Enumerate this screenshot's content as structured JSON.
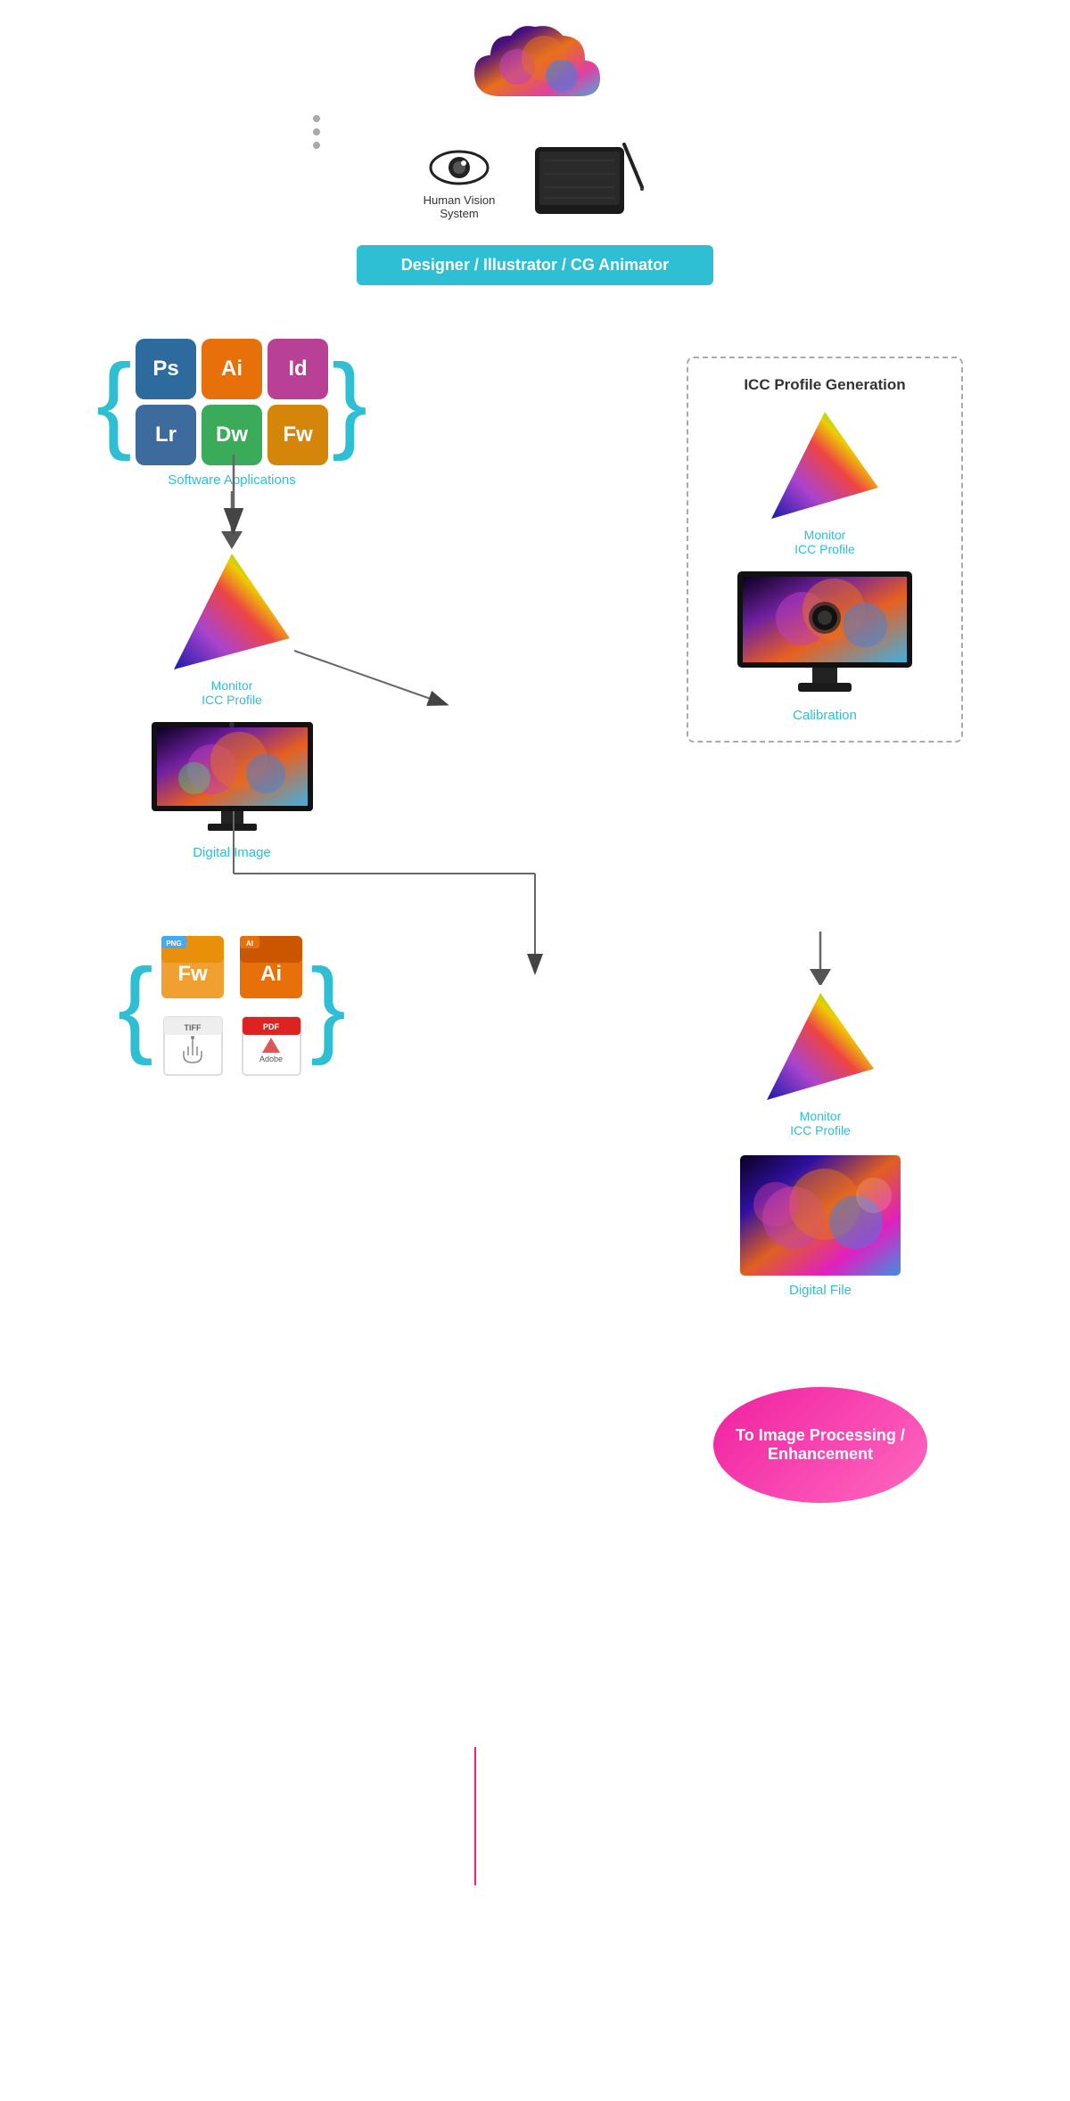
{
  "header": {
    "designer_label": "Designer / Illustrator / CG Animator",
    "human_vision_label": "Human Vision\nSystem"
  },
  "software": {
    "label": "Software Applications",
    "apps": [
      {
        "abbr": "Ps",
        "bg": "#2d6b9e"
      },
      {
        "abbr": "Ai",
        "bg": "#e8700a"
      },
      {
        "abbr": "Id",
        "bg": "#b84095"
      },
      {
        "abbr": "Lr",
        "bg": "#3d6b9e"
      },
      {
        "abbr": "Dw",
        "bg": "#3aab58"
      },
      {
        "abbr": "Fw",
        "bg": "#d4860a"
      }
    ]
  },
  "icc_box": {
    "title": "ICC Profile Generation",
    "monitor_icc_label": "Monitor\nICC Profile",
    "calibration_label": "Calibration"
  },
  "left_flow": {
    "monitor_icc_label": "Monitor\nICC Profile",
    "digital_image_label": "Digital Image"
  },
  "bottom_section": {
    "monitor_icc_label": "Monitor\nICC Profile",
    "digital_file_label": "Digital File",
    "cta_label": "To Image Processing /\nEnhancement"
  },
  "colors": {
    "teal": "#2ebfd4",
    "pink": "#e91e8c",
    "orange": "#e8700a"
  }
}
